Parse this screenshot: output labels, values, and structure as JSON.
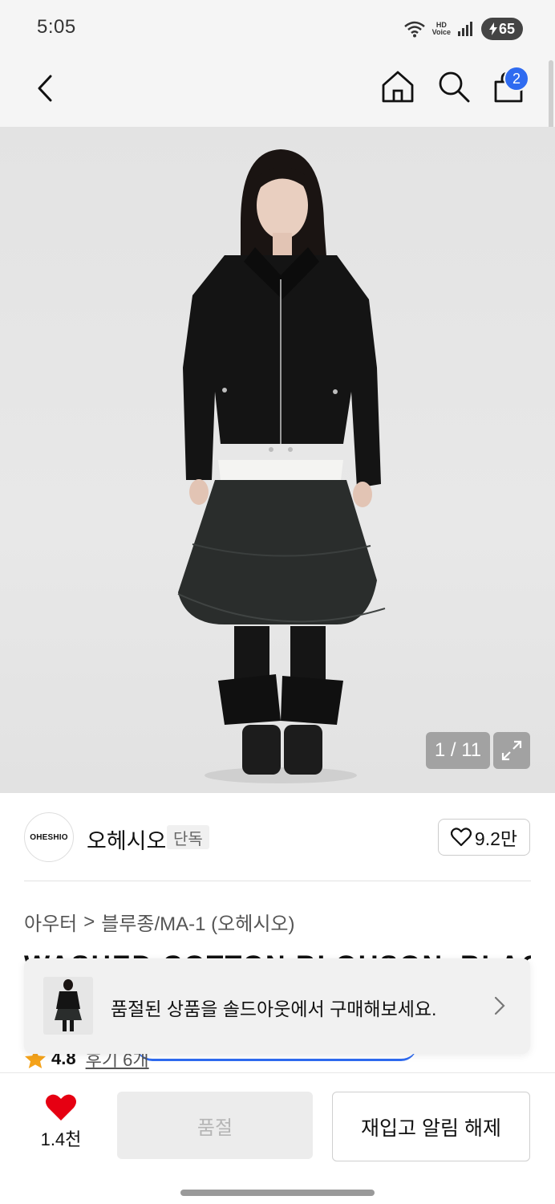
{
  "status_bar": {
    "time": "5:05",
    "hd_voice_top": "HD",
    "hd_voice_bottom": "Voice",
    "battery": "65",
    "icons": [
      "wifi-icon",
      "hd-voice-icon",
      "signal-icon",
      "battery-charging-icon"
    ]
  },
  "header": {
    "icons": [
      "back-arrow-icon",
      "home-icon",
      "search-icon",
      "shopping-bag-icon"
    ],
    "cart_count": "2"
  },
  "gallery": {
    "counter": "1 / 11",
    "icons": [
      "expand-icon"
    ]
  },
  "brand": {
    "logo_text": "OHESHIO",
    "name": "오헤시오",
    "tag": "단독",
    "like_count": "9.2만"
  },
  "breadcrumb": {
    "category": "아우터",
    "separator": ">",
    "subcategory": "블루종/MA-1 (오헤시오)"
  },
  "product": {
    "title": "WASHED COTTON BLOUSON_BLACK",
    "rating": "4.8",
    "reviews": "후기 6개"
  },
  "banner": {
    "text": "품절된 상품을 솔드아웃에서 구매해보세요."
  },
  "bottom_bar": {
    "wish_count": "1.4천",
    "soldout_label": "품절",
    "restock_label": "재입고 알림 해제"
  },
  "colors": {
    "accent": "#2f6bf0",
    "heart": "#e60012",
    "star": "#f5a31a"
  }
}
